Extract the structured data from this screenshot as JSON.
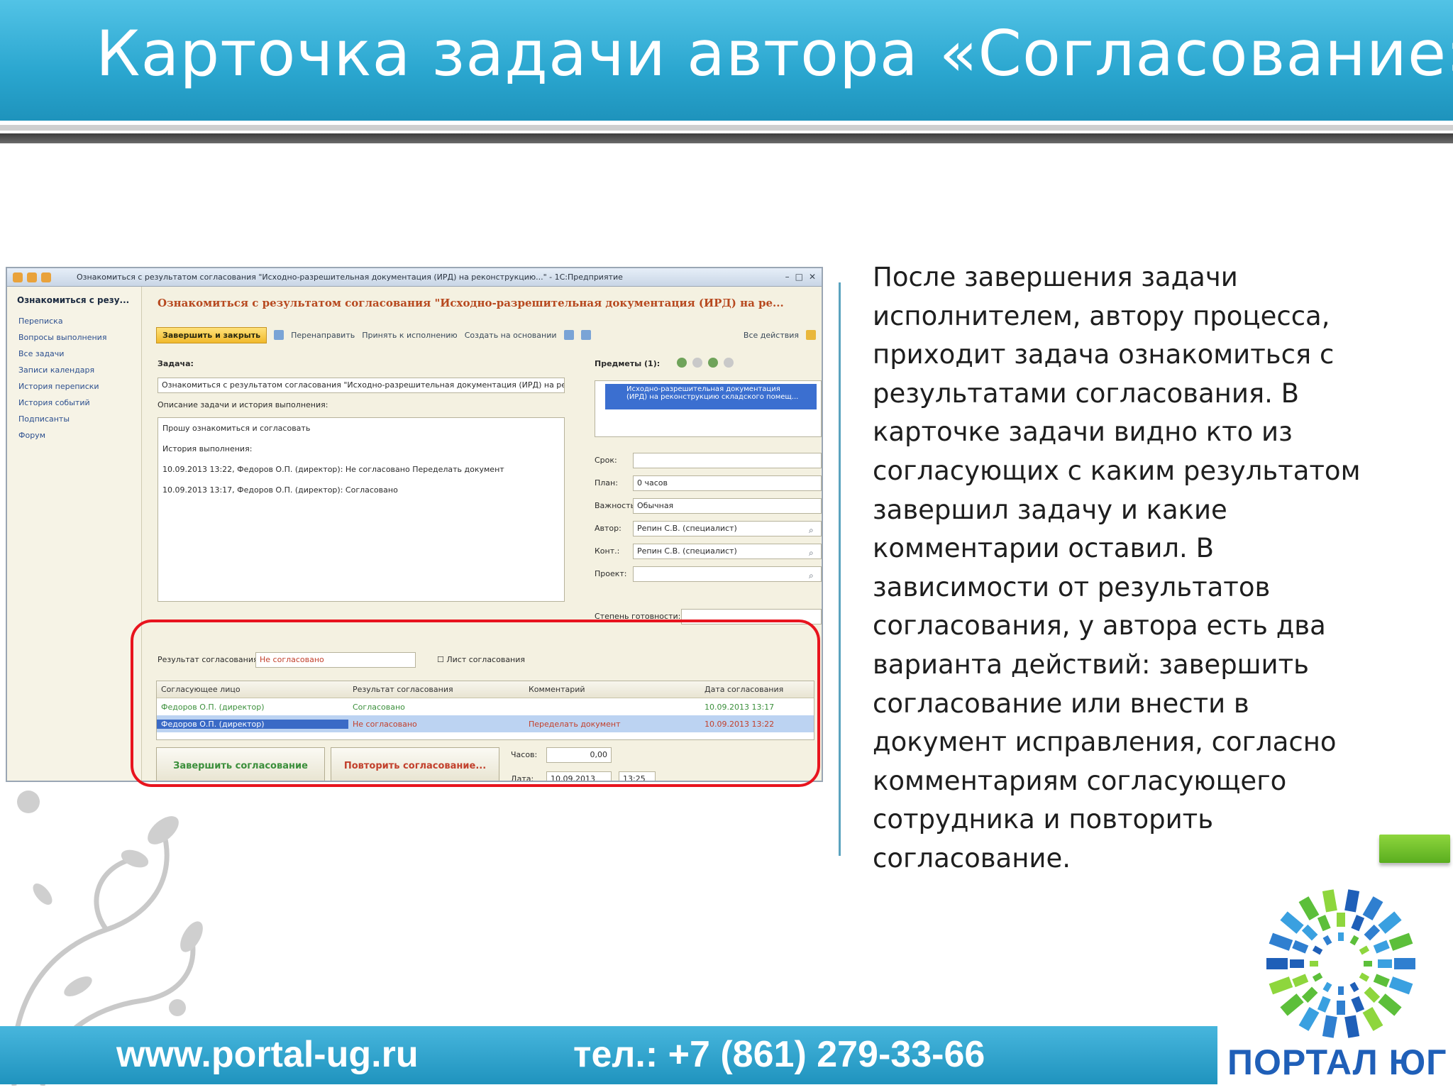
{
  "slide": {
    "title": "Карточка задачи автора «Согласование»",
    "description_lines": [
      "После завершения задачи",
      "исполнителем, автору процесса,",
      "приходит задача ознакомиться с",
      "результатами согласования. В",
      "карточке задачи видно кто из",
      "согласующих с каким результатом",
      "завершил задачу и какие",
      "комментарии оставил. В",
      "зависимости от результатов",
      "согласования, у автора есть два",
      "варианта действий: завершить",
      "согласование или внести в",
      "документ исправления, согласно",
      "комментариям согласующего",
      "сотрудника и повторить",
      "согласование."
    ],
    "footer": {
      "url": "www.portal-ug.ru",
      "phone": "тел.: +7 (861) 279-33-66"
    },
    "logo_text": "ПОРТАЛ ЮГ"
  },
  "colors": {
    "header": "#2aa6cf",
    "highlight_frame": "#e8141e",
    "accent_green": "#6bbf2a",
    "logo_blue": "#1f5fb8"
  },
  "window": {
    "titlebar_text": "Ознакомиться с результатом согласования \"Исходно-разрешительная документация (ИРД) на реконструкцию...\" - 1С:Предприятие",
    "nav": {
      "title": "Ознакомиться с резу...",
      "items": [
        "Переписка",
        "Вопросы выполнения",
        "Все задачи",
        "Записи календаря",
        "История переписки",
        "История событий",
        "Подписанты",
        "Форум"
      ]
    },
    "task_title": "Ознакомиться с результатом согласования \"Исходно-разрешительная документация (ИРД) на ре...",
    "toolbar": {
      "close_button": "Завершить и закрыть",
      "forward": "Перенаправить",
      "accept": "Принять к исполнению",
      "create_based": "Создать на основании",
      "all_actions": "Все действия"
    },
    "task_label": "Задача:",
    "task_name": "Ознакомиться с результатом согласования \"Исходно-разрешительная документация (ИРД) на рек",
    "history_label": "Описание задачи и история выполнения:",
    "history": [
      "Прошу ознакомиться и согласовать",
      "История выполнения:",
      "10.09.2013 13:22, Федоров О.П. (директор): Не согласовано Переделать документ",
      "10.09.2013 13:17, Федоров О.П. (директор): Согласовано"
    ],
    "subjects_label": "Предметы (1):",
    "subject_item": [
      "Исходно-разрешительная документация",
      "(ИРД) на реконструкцию складского помещ..."
    ],
    "fields": [
      {
        "label": "Срок:",
        "value": ""
      },
      {
        "label": "План:",
        "value": "0 часов"
      },
      {
        "label": "Важность:",
        "value": "Обычная"
      },
      {
        "label": "Автор:",
        "value": "Репин С.В. (специалист)"
      },
      {
        "label": "Конт.:",
        "value": "Репин С.В. (специалист)"
      },
      {
        "label": "Проект:",
        "value": ""
      }
    ],
    "confidentiality_label": "Степень готовности:",
    "result_label": "Результат согласования:",
    "result_value": "Не согласовано",
    "approval_sheet": "Лист согласования",
    "grid": {
      "headers": [
        "Согласующее лицо",
        "Результат согласования",
        "Комментарий",
        "Дата согласования"
      ],
      "rows": [
        [
          "Федоров О.П. (директор)",
          "Согласовано",
          "",
          "10.09.2013 13:17"
        ],
        [
          "Федоров О.П. (директор)",
          "Не согласовано",
          "Переделать документ",
          "10.09.2013 13:22"
        ]
      ]
    },
    "finish_button": "Завершить согласование",
    "repeat_button": "Повторить согласование...",
    "hours_label": "Часов:",
    "hours_value": "0,00",
    "date_label": "Дата:",
    "date_value": "10.09.2013",
    "time_value": "13:25"
  }
}
